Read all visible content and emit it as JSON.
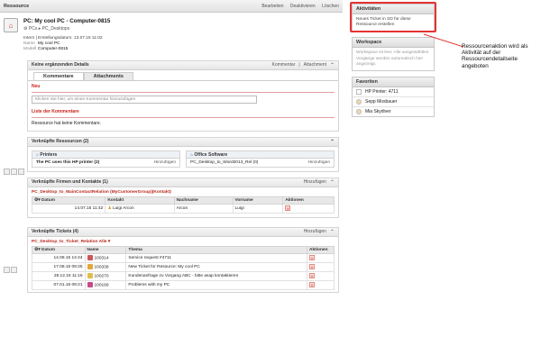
{
  "topbar": {
    "title": "Ressource",
    "actions": [
      "Bearbeiten",
      "Deaktivieren",
      "Löschen"
    ]
  },
  "resource": {
    "title": "PC: My cool PC - Computer-0815",
    "crumb_icon": "gear-icon",
    "crumb1": "PCs",
    "crumb2": "PC_Desktops",
    "meta_line": "Intern | Erstellungsdatum: 13.07.15 11:02",
    "name_key": "Name",
    "name_val": "My cool PC",
    "model_key": "Modell",
    "model_val": "Computer-0815"
  },
  "details": {
    "title": "Keine ergänzenden Details",
    "right1": "Kommentar",
    "right2": "Attachment",
    "tab1": "Kommentare",
    "tab2": "Attachments",
    "new_label": "Neu",
    "input_placeholder": "Klicken Sie hier, um einen Kommentar hinzuzufügen",
    "list_title": "Liste der Kommentare",
    "no_comments": "Ressource hat keine Kommentare."
  },
  "resources": {
    "title": "Verknüpfte Ressourcen (2)",
    "box1_title": "Printers",
    "box1_item": "The PC uses this HP printer (2)",
    "box2_title": "Office Software",
    "box2_item": "PC_Desktop_to_Word2013_Rel (0)",
    "add": "Hinzufügen"
  },
  "companies": {
    "title": "Verknüpfte Firmen und Kontakte (1)",
    "add": "Hinzufügen",
    "relation": "PC_Desktop_to_MainContactRelation (MyCustomerGroup)(Kontakt)",
    "columns": [
      "Datum",
      "Kontakt",
      "Nachname",
      "Vorname",
      "Aktionen"
    ],
    "row": {
      "date": "14.07.15 11:42",
      "contact": "Luigi Arcon",
      "last": "Arcon",
      "first": "Luigi"
    }
  },
  "tickets": {
    "title": "Verknüpfte Tickets (4)",
    "add": "Hinzufügen",
    "relation": "PC_Desktop_to_Ticket_Relation Alle",
    "columns": [
      "Datum",
      "Name",
      "Thema",
      "Aktionen"
    ],
    "rows": [
      {
        "date": "14.08.15 14:44",
        "name": "100314",
        "topic": "Service request #4711"
      },
      {
        "date": "17.08.15 09:25",
        "name": "100338",
        "topic": "New Ticket for Resource: My cool PC"
      },
      {
        "date": "28.12.15 11:16",
        "name": "100270",
        "topic": "Kundenanfrage zu Vorgang ABC - bitte asap kontaktieren"
      },
      {
        "date": "07.01.16 09:21",
        "name": "100199",
        "topic": "Problems with my PC"
      }
    ]
  },
  "sidebar": {
    "activities_title": "Aktivitäten",
    "activities_item": "Neues Ticket in SD für diese Ressource erstellen",
    "workspace_title": "Workspace",
    "workspace_text": "Workspace ist leer. Alle ausgewählten Vorgänge werden automatisch hier angezeigt.",
    "favorites_title": "Favoriten",
    "favorites": [
      "HP Printer: 4711",
      "Sepp Mosbauer",
      "Mia Skydiver"
    ]
  },
  "annotation": "Ressourcenaktion wird als Aktivität auf der Ressourcendetailseite angeboten",
  "colors": {
    "accent": "#c8251c",
    "highlight": "#e53333"
  }
}
